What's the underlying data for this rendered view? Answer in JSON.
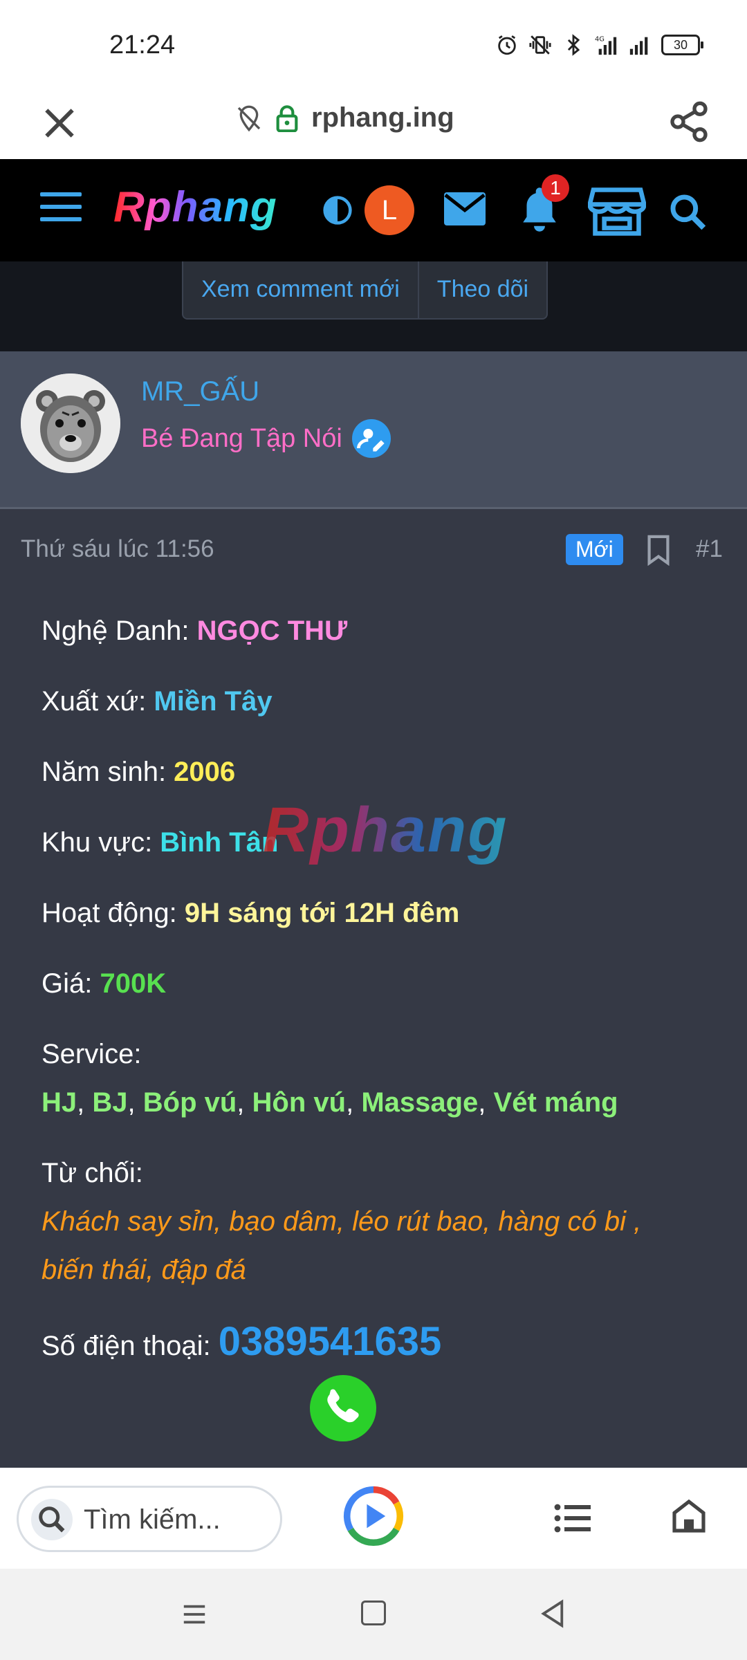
{
  "status_bar": {
    "time": "21:24",
    "battery": "30"
  },
  "browser": {
    "url": "rphang.ing"
  },
  "site_header": {
    "logo": "Rphang",
    "avatar_letter": "L",
    "notification_count": "1"
  },
  "actions": {
    "new_comments": "Xem comment mới",
    "follow": "Theo dõi"
  },
  "user": {
    "name": "MR_GẤU",
    "title": "Bé Đang Tập Nói"
  },
  "post": {
    "date": "Thứ sáu lúc 11:56",
    "badge": "Mới",
    "number": "#1",
    "stage_name_label": "Nghệ Danh: ",
    "stage_name": "NGỌC THƯ",
    "origin_label": "Xuất xứ: ",
    "origin": "Miền Tây",
    "birth_year_label": "Năm sinh: ",
    "birth_year": "2006",
    "area_label": "Khu vực: ",
    "area": "Bình Tân",
    "hours_label": "Hoạt động: ",
    "hours": "9H sáng tới 12H đêm",
    "price_label": "Giá: ",
    "price": "700K",
    "service_label": "Service:",
    "services": [
      "HJ",
      "BJ",
      "Bóp vú",
      "Hôn vú",
      "Massage",
      "Vét máng"
    ],
    "reject_label": "Từ chối:",
    "reject_line1": "Khách say sỉn, bạo dâm, léo rút bao, hàng có bi ,",
    "reject_line2": "biến thái, đập đá",
    "phone_label": "Số điện thoại: ",
    "phone": "0389541635",
    "watermark": "Rphang"
  },
  "bottom_toolbar": {
    "search_placeholder": "Tìm kiếm..."
  },
  "colors": {
    "header_bg": "#000000",
    "post_bg": "#353945",
    "userbar_bg": "#474e5e",
    "accent_blue": "#3fa6ea",
    "pink": "#ff8ae0",
    "yellow": "#ffee58",
    "green": "#58e050",
    "orange": "#ff9a1a"
  }
}
